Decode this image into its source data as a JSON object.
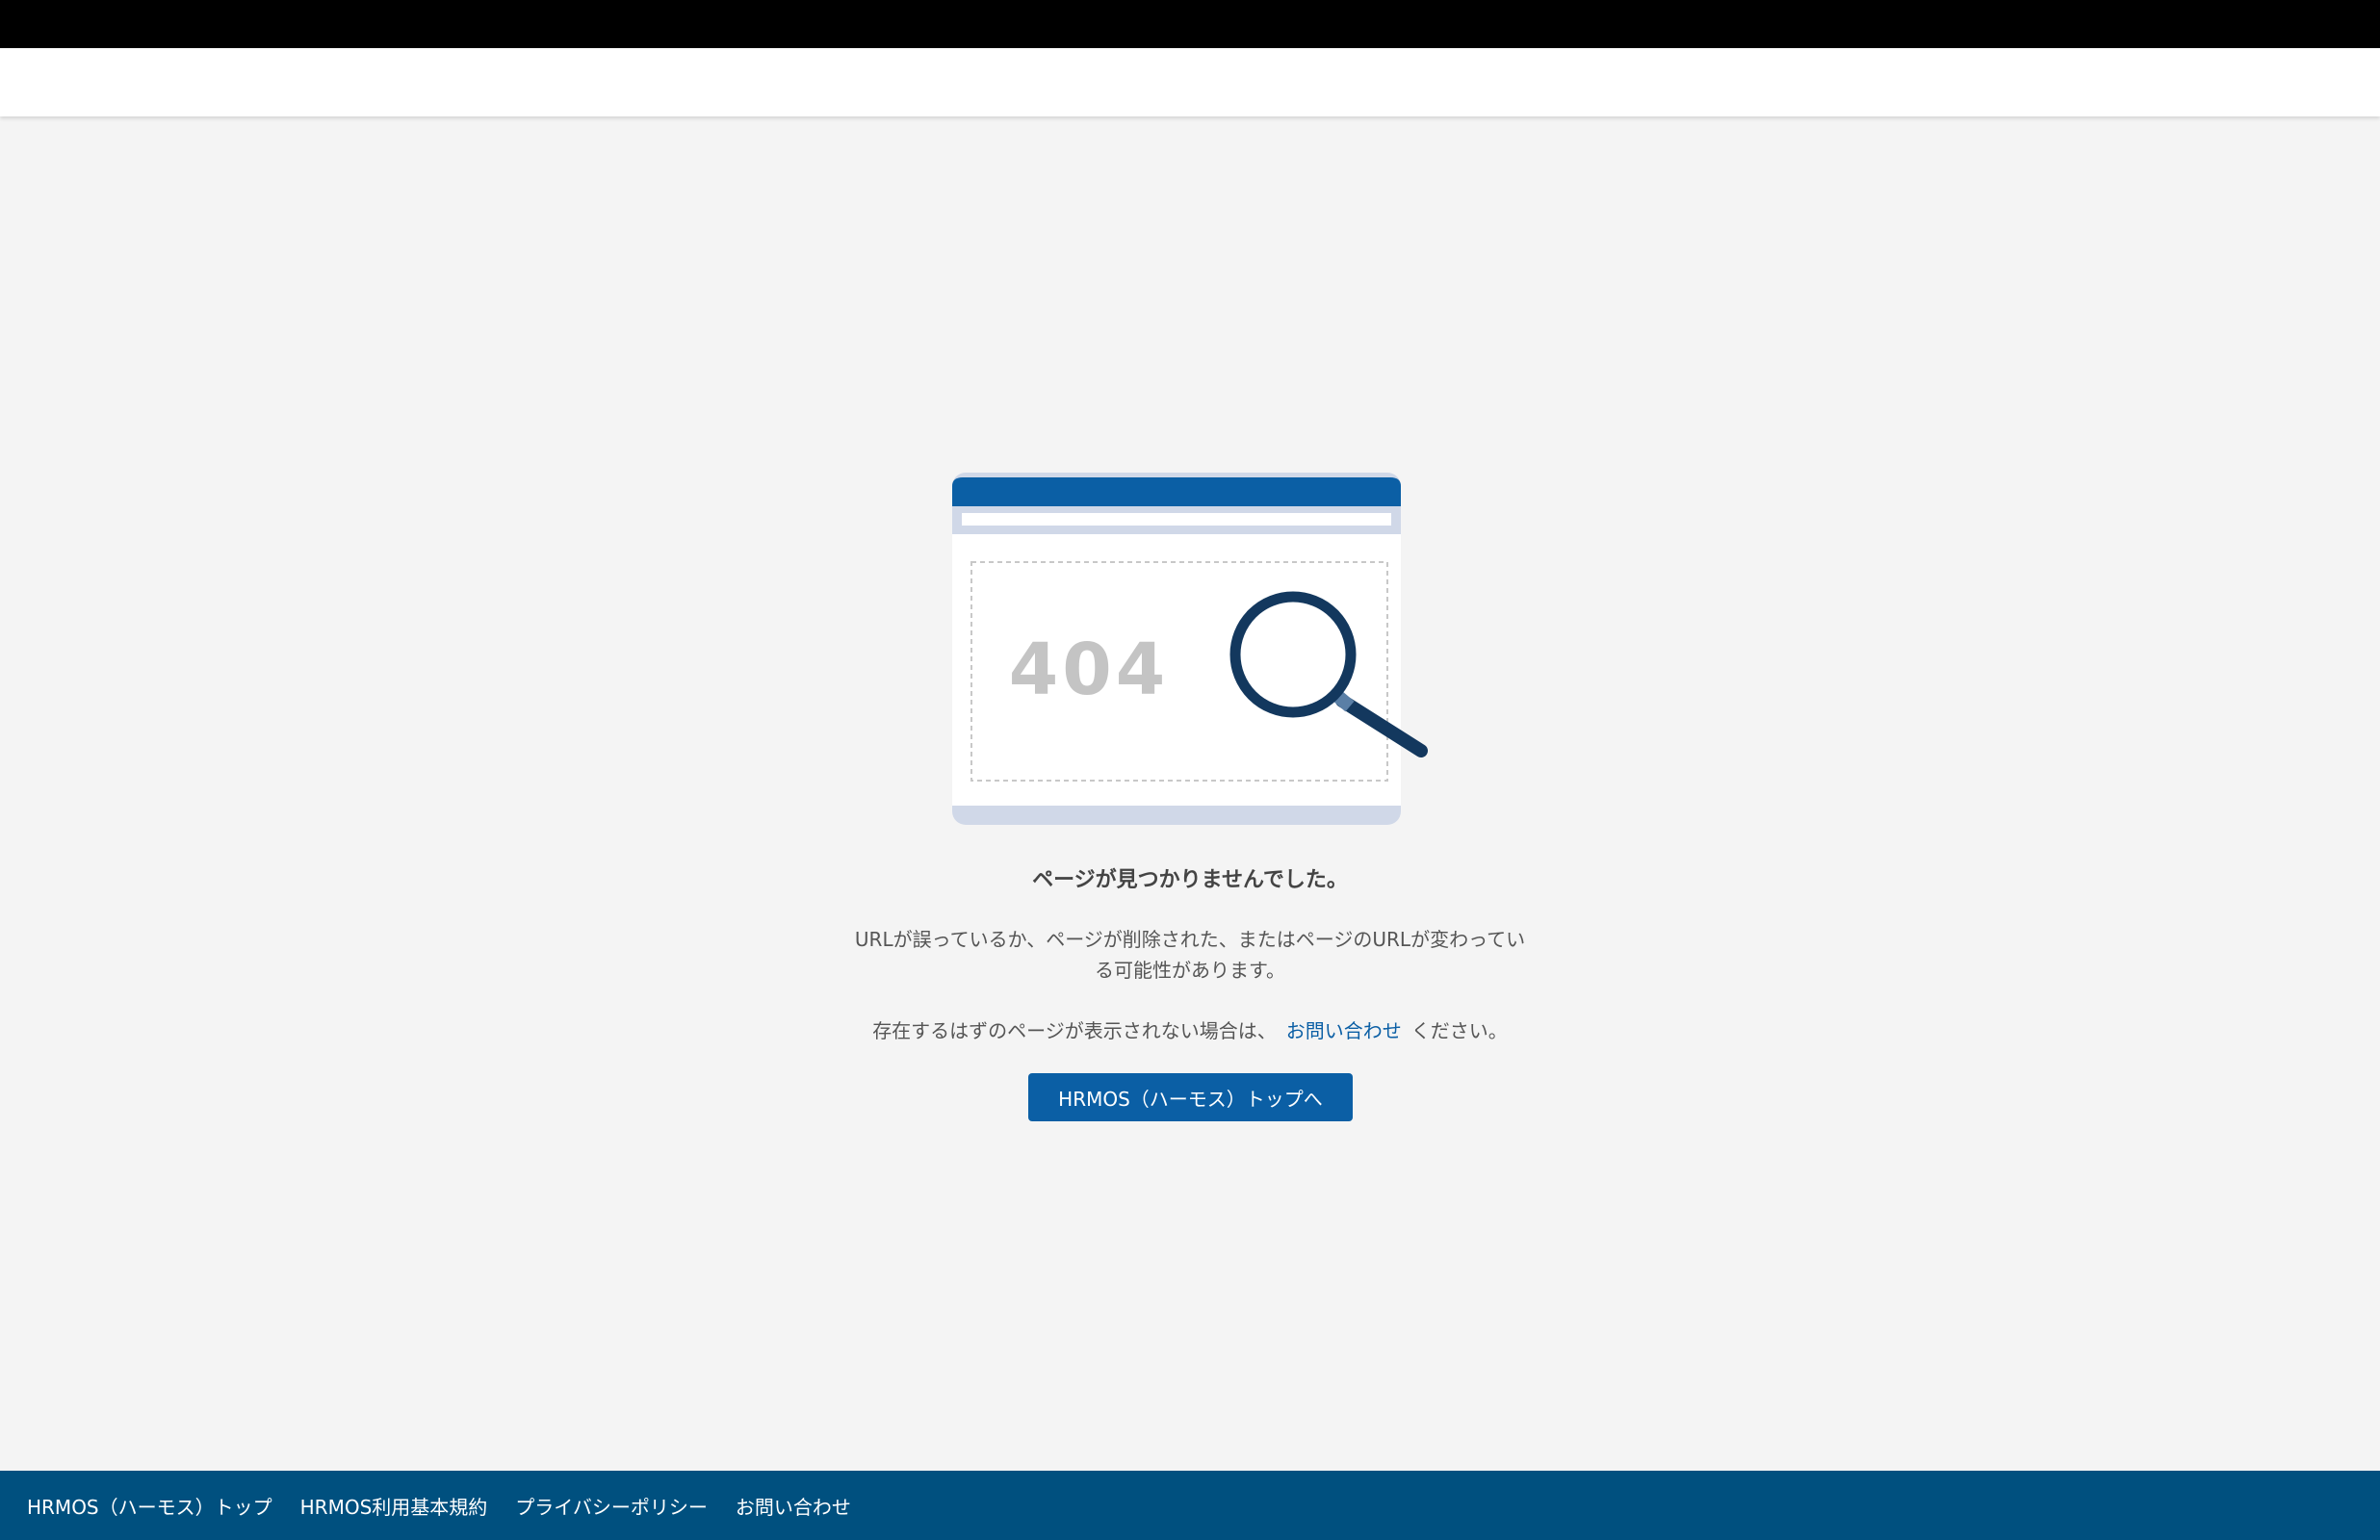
{
  "illustration": {
    "code_text": "404",
    "colors": {
      "accent": "#0b5fa5",
      "frame": "#d0d8e8",
      "magnifier": "#13385e",
      "code": "#c4c4c4"
    }
  },
  "main": {
    "title": "ページが見つかりませんでした。",
    "description": "URLが誤っているか、ページが削除された、またはページのURLが変わっている可能性があります。",
    "contact_prefix": "存在するはずのページが表示されない場合は、",
    "contact_link": "お問い合わせ",
    "contact_suffix": "ください。",
    "top_button_label": "HRMOS（ハーモス）トップへ"
  },
  "footer": {
    "links": [
      "HRMOS（ハーモス）トップ",
      "HRMOS利用基本規約",
      "プライバシーポリシー",
      "お問い合わせ"
    ],
    "background": "#00507f"
  }
}
